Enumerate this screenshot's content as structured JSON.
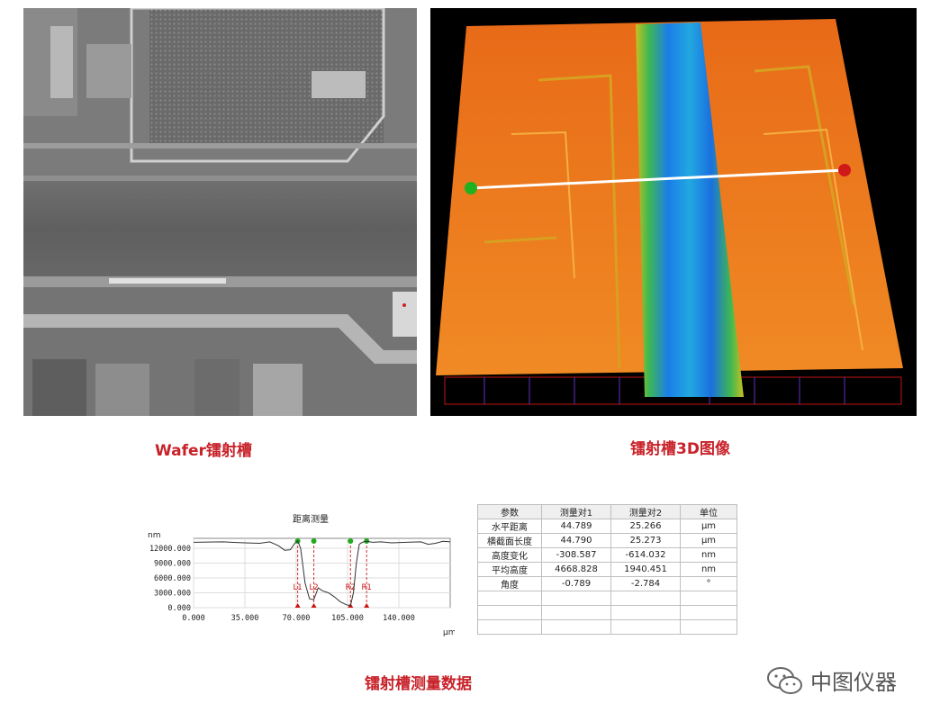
{
  "captions": {
    "wafer": "Wafer镭射槽",
    "view3d": "镭射槽3D图像",
    "data": "镭射槽测量数据"
  },
  "brand": {
    "name": "中图仪器",
    "icon": "wechat-icon"
  },
  "colors": {
    "caption": "#c8222a",
    "marker_green": "#22aa22",
    "marker_red": "#cc1111"
  },
  "chart_data": {
    "type": "line",
    "title": "距离测量",
    "ylabel": "nm",
    "xlabel": "μm",
    "x_ticks": [
      "0.000",
      "35.000",
      "70.000",
      "105.000",
      "140.000"
    ],
    "y_ticks": [
      "12000.000",
      "9000.000",
      "6000.000",
      "3000.000",
      "0.000"
    ],
    "xlim": [
      0,
      175
    ],
    "ylim": [
      0,
      14000
    ],
    "grid": true,
    "cursor_labels": [
      "L1",
      "L2",
      "R2",
      "R1"
    ],
    "cursor_x": [
      71,
      82,
      107,
      118
    ],
    "series": [
      {
        "x": [
          0,
          20,
          35,
          45,
          52,
          58,
          62,
          66,
          69,
          71,
          73,
          76,
          79,
          82,
          85,
          88,
          92,
          96,
          100,
          104,
          107,
          109,
          111,
          113,
          115,
          118,
          122,
          128,
          135,
          145,
          155,
          160,
          165,
          170,
          175
        ],
        "values": [
          13200,
          13300,
          13100,
          13000,
          13300,
          12500,
          11600,
          11700,
          13000,
          13500,
          12000,
          5000,
          1800,
          1600,
          4000,
          3400,
          3000,
          2200,
          1200,
          600,
          400,
          3000,
          9000,
          12800,
          13200,
          13400,
          13200,
          13300,
          13100,
          13200,
          13300,
          12800,
          13000,
          13400,
          13300
        ]
      }
    ]
  },
  "table": {
    "headers": [
      "参数",
      "测量对1",
      "测量对2",
      "单位"
    ],
    "rows": [
      [
        "水平距离",
        "44.789",
        "25.266",
        "μm"
      ],
      [
        "横截面长度",
        "44.790",
        "25.273",
        "μm"
      ],
      [
        "高度变化",
        "-308.587",
        "-614.032",
        "nm"
      ],
      [
        "平均高度",
        "4668.828",
        "1940.451",
        "nm"
      ],
      [
        "角度",
        "-0.789",
        "-2.784",
        "°"
      ]
    ]
  }
}
